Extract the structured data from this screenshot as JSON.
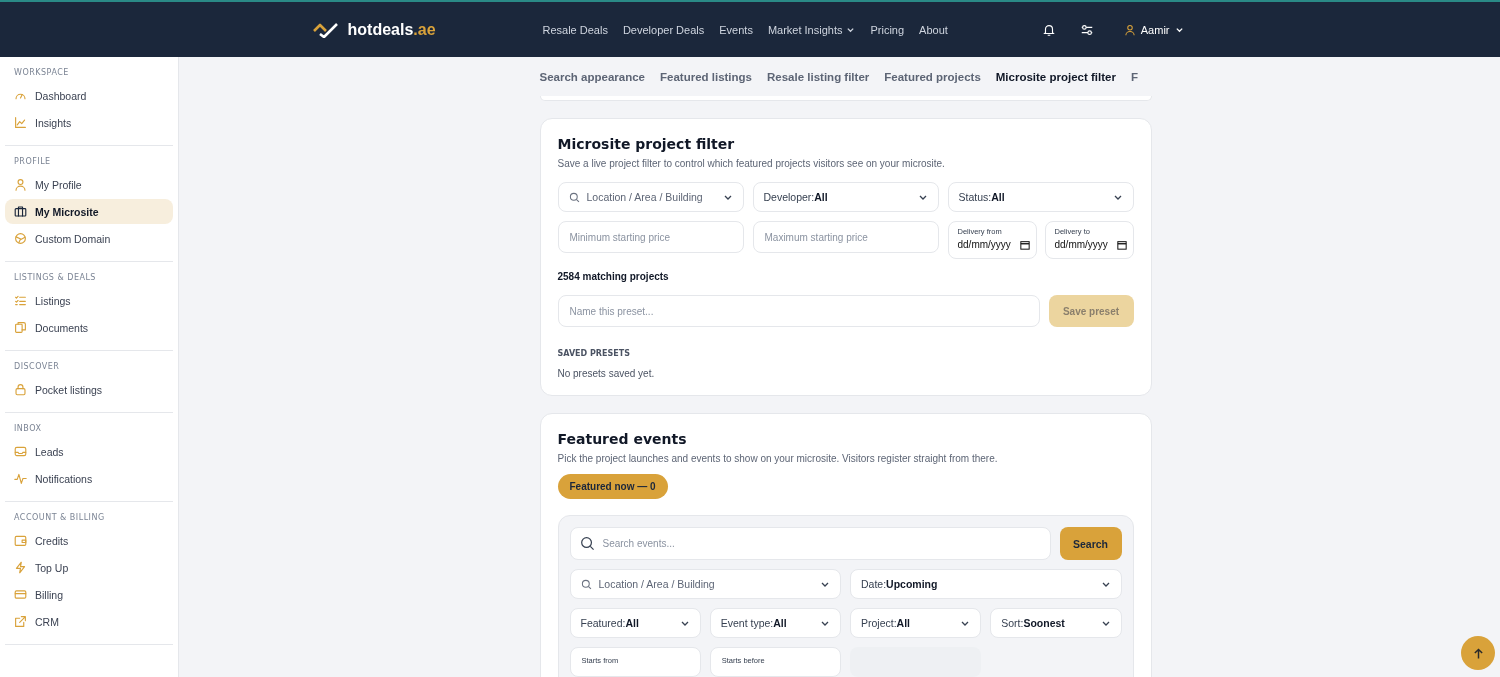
{
  "header": {
    "logo": {
      "name": "hotdeals",
      "suffix": ".ae"
    },
    "nav": [
      {
        "label": "Resale Deals",
        "dropdown": false
      },
      {
        "label": "Developer Deals",
        "dropdown": false
      },
      {
        "label": "Events",
        "dropdown": false
      },
      {
        "label": "Market Insights",
        "dropdown": true
      },
      {
        "label": "Pricing",
        "dropdown": false
      },
      {
        "label": "About",
        "dropdown": false
      }
    ],
    "user": {
      "name": "Aamir"
    }
  },
  "sidebar": {
    "sections": [
      {
        "title": "WORKSPACE",
        "items": [
          {
            "label": "Dashboard",
            "selected": false
          },
          {
            "label": "Insights",
            "selected": false
          }
        ]
      },
      {
        "title": "PROFILE",
        "items": [
          {
            "label": "My Profile",
            "selected": false
          },
          {
            "label": "My Microsite",
            "selected": true
          },
          {
            "label": "Custom Domain",
            "selected": false
          }
        ]
      },
      {
        "title": "LISTINGS & DEALS",
        "items": [
          {
            "label": "Listings",
            "selected": false
          },
          {
            "label": "Documents",
            "selected": false
          }
        ]
      },
      {
        "title": "DISCOVER",
        "items": [
          {
            "label": "Pocket listings",
            "selected": false
          }
        ]
      },
      {
        "title": "INBOX",
        "items": [
          {
            "label": "Leads",
            "selected": false
          },
          {
            "label": "Notifications",
            "selected": false
          }
        ]
      },
      {
        "title": "ACCOUNT & BILLING",
        "items": [
          {
            "label": "Credits",
            "selected": false
          },
          {
            "label": "Top Up",
            "selected": false
          },
          {
            "label": "Billing",
            "selected": false
          },
          {
            "label": "CRM",
            "selected": false
          }
        ]
      }
    ]
  },
  "tabs": [
    {
      "label": "Search appearance",
      "selected": false
    },
    {
      "label": "Featured listings",
      "selected": false
    },
    {
      "label": "Resale listing filter",
      "selected": false
    },
    {
      "label": "Featured projects",
      "selected": false
    },
    {
      "label": "Microsite project filter",
      "selected": true
    },
    {
      "label": "F",
      "selected": false
    }
  ],
  "project_filter": {
    "title": "Microsite project filter",
    "description": "Save a live project filter to control which featured projects visitors see on your microsite.",
    "selects": [
      {
        "kind": "search",
        "label": "Location / Area / Building"
      },
      {
        "kind": "select",
        "label": "Developer:",
        "value": "All"
      },
      {
        "kind": "select",
        "label": "Status:",
        "value": "All"
      }
    ],
    "price_fields": [
      {
        "placeholder": "Minimum starting price"
      },
      {
        "placeholder": "Maximum starting price"
      }
    ],
    "date_fields": [
      {
        "label": "Delivery from",
        "placeholder": "dd/mm/yyyy"
      },
      {
        "label": "Delivery to",
        "placeholder": "dd/mm/yyyy"
      }
    ],
    "match_count": "2584 matching projects",
    "preset_field": {
      "placeholder": "Name this preset..."
    },
    "save_button": {
      "label": "Save preset",
      "disabled": true
    },
    "saved_presets": {
      "title": "SAVED PRESETS",
      "empty": "No presets saved yet."
    }
  },
  "featured_events": {
    "title": "Featured events",
    "description": "Pick the project launches and events to show on your microsite. Visitors register straight from there.",
    "badge": "Featured now — 0",
    "search": {
      "placeholder": "Search events...",
      "button": "Search"
    },
    "wide_selects": [
      {
        "kind": "search",
        "label": "Location / Area / Building"
      },
      {
        "kind": "select",
        "label": "Date:",
        "value": "Upcoming"
      }
    ],
    "selects": [
      {
        "label": "Featured:",
        "value": "All"
      },
      {
        "label": "Event type:",
        "value": "All"
      },
      {
        "label": "Project:",
        "value": "All"
      },
      {
        "label": "Sort:",
        "value": "Soonest"
      }
    ],
    "date_fields": [
      {
        "label": "Starts from"
      },
      {
        "label": "Starts before"
      }
    ]
  }
}
